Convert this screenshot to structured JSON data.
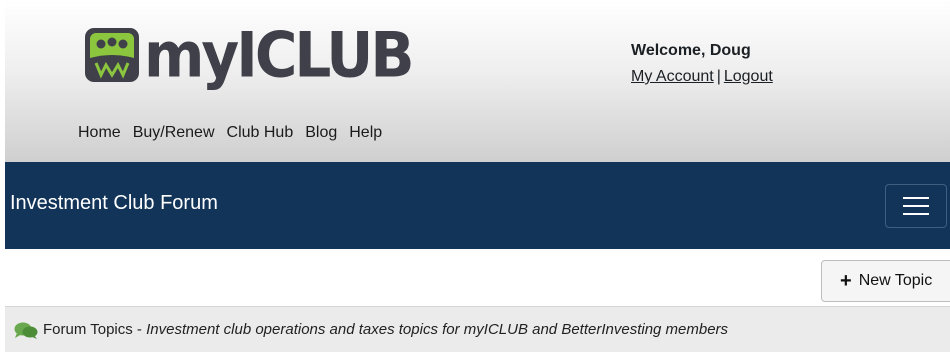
{
  "logo": {
    "text": "myICLUB"
  },
  "user": {
    "welcome": "Welcome, Doug",
    "account_link": "My Account",
    "separator": "|",
    "logout_link": "Logout"
  },
  "nav": {
    "items": [
      "Home",
      "Buy/Renew",
      "Club Hub",
      "Blog",
      "Help"
    ]
  },
  "forum_bar": {
    "title": "Investment Club Forum",
    "menu_icon": "hamburger-icon"
  },
  "actions": {
    "new_topic_label": "New Topic",
    "new_topic_icon": "plus-icon"
  },
  "topics": {
    "icon": "chat-bubbles-icon",
    "label": "Forum Topics",
    "separator": " - ",
    "description": "Investment club operations and taxes topics for myICLUB and BetterInvesting members"
  },
  "colors": {
    "forum_bar": "#123459",
    "logo_text": "#3f4049",
    "logo_icon": "#8cc63f"
  }
}
